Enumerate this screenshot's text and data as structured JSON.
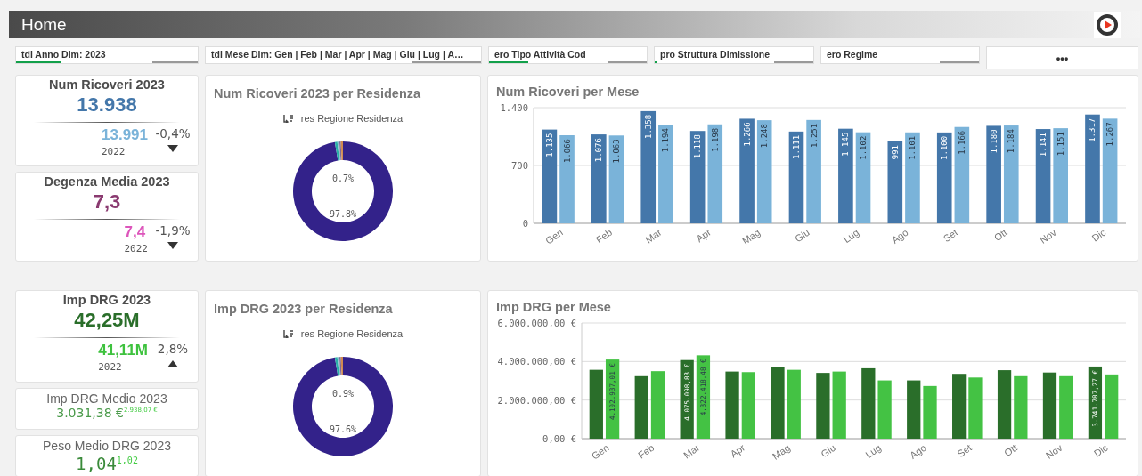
{
  "header": {
    "title": "Home"
  },
  "filters": [
    {
      "label": "tdi Anno Dim: 2023",
      "level": 0.25
    },
    {
      "label": "tdi Mese Dim: Gen | Feb | Mar | Apr | Mag | Giu | Lug | A…",
      "level": 0
    },
    {
      "label": "ero Tipo Attività Cod",
      "level": 0.25
    },
    {
      "label": "pro Struttura Dimissione",
      "level": 0.01
    },
    {
      "label": "ero Regime",
      "level": 0
    }
  ],
  "more_button": {
    "label": "•••"
  },
  "top_row": {
    "kpis": [
      {
        "kind": "comparison",
        "title": "Num Ricoveri 2023",
        "value": "13.938",
        "compare_value": "13.991",
        "compare_label": "2022",
        "change": "-0,4%",
        "increase": false
      },
      {
        "kind": "comparison",
        "title": "Degenza Media 2023",
        "value": "7,3",
        "compare_value": "7,4",
        "compare_label": "2022",
        "change": "-1,9%",
        "increase": false
      }
    ],
    "donut": {
      "title": "Num Ricoveri 2023 per Residenza",
      "legend": "res Regione Residenza",
      "labels": [
        "0.7%",
        "97.8%"
      ]
    },
    "bar_chart": {
      "title": "Num Ricoveri per Mese",
      "chart_data": {
        "type": "bar",
        "categories": [
          "Gen",
          "Feb",
          "Mar",
          "Apr",
          "Mag",
          "Giu",
          "Lug",
          "Ago",
          "Set",
          "Ott",
          "Nov",
          "Dic"
        ],
        "series": [
          {
            "color": "#4477aa",
            "values": [
              1135,
              1076,
              1358,
              1118,
              1266,
              1111,
              1145,
              991,
              1100,
              1180,
              1141,
              1317
            ]
          },
          {
            "color": "#7ab3d9",
            "values": [
              1066,
              1063,
              1194,
              1198,
              1248,
              1251,
              1102,
              1101,
              1166,
              1184,
              1151,
              1267
            ]
          }
        ],
        "ylim": [
          0,
          1400
        ],
        "yticks": [
          {
            "value": 0,
            "label": "0"
          },
          {
            "value": 700,
            "label": "700"
          },
          {
            "value": 1400,
            "label": "1.400"
          }
        ],
        "value_labels": [
          [
            "1.135",
            "1.076",
            "1.358",
            "1.118",
            "1.266",
            "1.111",
            "1.145",
            "991",
            "1.100",
            "1.180",
            "1.141",
            "1.317"
          ],
          [
            "1.066",
            "1.063",
            "1.194",
            "1.198",
            "1.248",
            "1.251",
            "1.102",
            "1.101",
            "1.166",
            "1.184",
            "1.151",
            "1.267"
          ]
        ]
      }
    }
  },
  "bottom_row": {
    "kpis": [
      {
        "kind": "comparison",
        "title": "Imp DRG 2023",
        "value": "42,25M",
        "compare_value": "41,11M",
        "compare_label": "2022",
        "change": "2,8%",
        "increase": true
      },
      {
        "kind": "simple",
        "title": "Imp DRG Medio 2023",
        "value": "3.031,38 €$^{2.938,07 €}$"
      },
      {
        "kind": "simple_large",
        "title": "Peso Medio DRG 2023",
        "value": "1,04$^{1,02}$"
      }
    ],
    "donut": {
      "title": "Imp DRG 2023 per Residenza",
      "legend": "res Regione Residenza",
      "labels": [
        "0.9%",
        "97.6%"
      ]
    },
    "bar_chart": {
      "title": "Imp DRG per Mese",
      "chart_data": {
        "type": "bar",
        "categories": [
          "Gen",
          "Feb",
          "Mar",
          "Apr",
          "Mag",
          "Giu",
          "Lug",
          "Ago",
          "Set",
          "Ott",
          "Nov",
          "Dic"
        ],
        "series": [
          {
            "color": "#2a6e2a",
            "values": [
              3570000,
              3240000,
              4075098.83,
              3480000,
              3720000,
              3410000,
              3650000,
              3020000,
              3360000,
              3550000,
              3430000,
              3741787.27
            ]
          },
          {
            "color": "#44c244",
            "values": [
              4102937.01,
              3500000,
              4322418.48,
              3450000,
              3570000,
              3480000,
              3020000,
              2730000,
              3170000,
              3240000,
              3240000,
              3330000
            ]
          }
        ],
        "ylim": [
          0,
          6000000
        ],
        "yticks": [
          {
            "value": 0,
            "label": "0,00 €"
          },
          {
            "value": 2000000,
            "label": "2.000.000,00 €"
          },
          {
            "value": 4000000,
            "label": "4.000.000,00 €"
          },
          {
            "value": 6000000,
            "label": "6.000.000,00 €"
          }
        ],
        "value_labels": [
          [
            null,
            null,
            "4.075.098,83 €",
            null,
            null,
            null,
            null,
            null,
            null,
            null,
            null,
            "3.741.787,27 €"
          ],
          [
            "4.102.937,01 €",
            null,
            "4.322.418,48 €",
            null,
            null,
            null,
            null,
            null,
            null,
            null,
            null,
            null
          ]
        ]
      }
    }
  }
}
